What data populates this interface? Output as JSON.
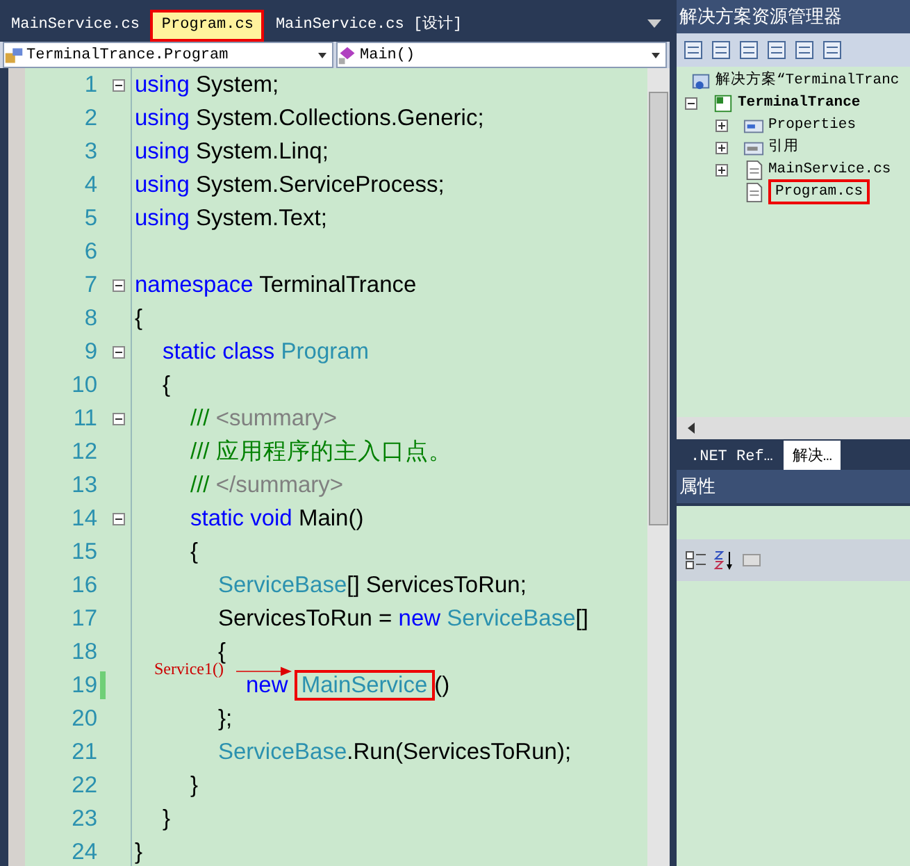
{
  "editor_tabs": [
    {
      "label": "MainService.cs",
      "selected": false,
      "highlighted": false
    },
    {
      "label": "Program.cs",
      "selected": true,
      "highlighted": true
    },
    {
      "label": "MainService.cs [设计]",
      "selected": false,
      "highlighted": false
    }
  ],
  "type_dropdown": {
    "value": "TerminalTrance.Program"
  },
  "member_dropdown": {
    "value": "Main()"
  },
  "code_lines": [
    {
      "number": "1",
      "fold": true,
      "changed": false,
      "tokens": [
        {
          "kind": "keyword",
          "text": "using"
        },
        {
          "kind": "plain",
          "text": " System;"
        }
      ]
    },
    {
      "number": "2",
      "changed": false,
      "tokens": [
        {
          "kind": "keyword",
          "text": "using"
        },
        {
          "kind": "plain",
          "text": " System.Collections.Generic;"
        }
      ]
    },
    {
      "number": "3",
      "changed": false,
      "tokens": [
        {
          "kind": "keyword",
          "text": "using"
        },
        {
          "kind": "plain",
          "text": " System.Linq;"
        }
      ]
    },
    {
      "number": "4",
      "changed": false,
      "tokens": [
        {
          "kind": "keyword",
          "text": "using"
        },
        {
          "kind": "plain",
          "text": " System.ServiceProcess;"
        }
      ]
    },
    {
      "number": "5",
      "changed": false,
      "tokens": [
        {
          "kind": "keyword",
          "text": "using"
        },
        {
          "kind": "plain",
          "text": " System.Text;"
        }
      ]
    },
    {
      "number": "6",
      "changed": false
    },
    {
      "number": "7",
      "fold": true,
      "changed": false,
      "tokens": [
        {
          "kind": "keyword",
          "text": "namespace"
        },
        {
          "kind": "plain",
          "text": " TerminalTrance"
        }
      ]
    },
    {
      "number": "8",
      "changed": false,
      "tokens": [
        {
          "kind": "plain",
          "text": "{"
        }
      ],
      "children": [
        {
          "number": "9",
          "fold": true,
          "changed": false,
          "tokens": [
            {
              "kind": "keyword",
              "text": "static class"
            },
            {
              "kind": "type",
              "text": " Program"
            }
          ]
        },
        {
          "number": "10",
          "changed": false,
          "tokens": [
            {
              "kind": "plain",
              "text": "{"
            }
          ],
          "children": [
            {
              "number": "11",
              "fold": true,
              "changed": false,
              "tokens": [
                {
                  "kind": "doc",
                  "text": "///"
                },
                {
                  "kind": "doctag",
                  "text": " <summary>"
                }
              ]
            },
            {
              "number": "12",
              "changed": false,
              "tokens": [
                {
                  "kind": "doc",
                  "text": "/// 应用程序的主入口点。"
                }
              ]
            },
            {
              "number": "13",
              "changed": false,
              "tokens": [
                {
                  "kind": "doc",
                  "text": "///"
                },
                {
                  "kind": "doctag",
                  "text": " </summary>"
                }
              ]
            },
            {
              "number": "14",
              "fold": true,
              "changed": false,
              "tokens": [
                {
                  "kind": "keyword",
                  "text": "static void"
                },
                {
                  "kind": "plain",
                  "text": " Main()"
                }
              ]
            },
            {
              "number": "15",
              "changed": false,
              "tokens": [
                {
                  "kind": "plain",
                  "text": "{"
                }
              ],
              "children": [
                {
                  "number": "16",
                  "changed": false,
                  "tokens": [
                    {
                      "kind": "type",
                      "text": "ServiceBase"
                    },
                    {
                      "kind": "plain",
                      "text": "[] ServicesToRun;"
                    }
                  ]
                },
                {
                  "number": "17",
                  "changed": false,
                  "tokens": [
                    {
                      "kind": "plain",
                      "text": "ServicesToRun = "
                    },
                    {
                      "kind": "keyword",
                      "text": "new"
                    },
                    {
                      "kind": "type",
                      "text": " ServiceBase"
                    },
                    {
                      "kind": "plain",
                      "text": "[]"
                    }
                  ]
                },
                {
                  "number": "18",
                  "changed": false,
                  "tokens": [
                    {
                      "kind": "plain",
                      "text": "{"
                    }
                  ],
                  "children": [
                    {
                      "number": "19",
                      "changed": true,
                      "annotation": "Service1()",
                      "tokens": [
                        {
                          "kind": "keyword",
                          "text": "new "
                        },
                        {
                          "kind": "type",
                          "text": "MainService",
                          "highlighted": true
                        },
                        {
                          "kind": "plain",
                          "text": "()"
                        }
                      ]
                    }
                  ]
                },
                {
                  "number": "20",
                  "changed": false,
                  "tokens": [
                    {
                      "kind": "plain",
                      "text": "};"
                    }
                  ]
                },
                {
                  "number": "21",
                  "changed": false,
                  "tokens": [
                    {
                      "kind": "type",
                      "text": "ServiceBase"
                    },
                    {
                      "kind": "plain",
                      "text": ".Run(ServicesToRun);"
                    }
                  ]
                }
              ]
            },
            {
              "number": "22",
              "changed": false,
              "tokens": [
                {
                  "kind": "plain",
                  "text": "}"
                }
              ]
            }
          ]
        },
        {
          "number": "23",
          "changed": false,
          "tokens": [
            {
              "kind": "plain",
              "text": "}"
            }
          ]
        }
      ]
    },
    {
      "number": "24",
      "changed": false,
      "tokens": [
        {
          "kind": "plain",
          "text": "}"
        }
      ]
    }
  ],
  "solution_explorer": {
    "title": "解决方案资源管理器",
    "tree": [
      {
        "label": "解决方案“TerminalTranc",
        "kind": "solution",
        "children": [
          {
            "label": "TerminalTrance",
            "kind": "project",
            "expanded": true,
            "children": [
              {
                "label": "Properties",
                "kind": "properties",
                "expanded": false
              },
              {
                "label": "引用",
                "kind": "references",
                "expanded": false
              },
              {
                "label": "MainService.cs",
                "kind": "file",
                "expanded": false
              },
              {
                "label": "Program.cs",
                "kind": "file",
                "highlighted": true
              }
            ]
          }
        ]
      }
    ],
    "bottom_tabs": [
      {
        "label": ".NET Ref…",
        "selected": false
      },
      {
        "label": "解决…",
        "selected": true
      }
    ]
  },
  "properties": {
    "title": "属性"
  }
}
